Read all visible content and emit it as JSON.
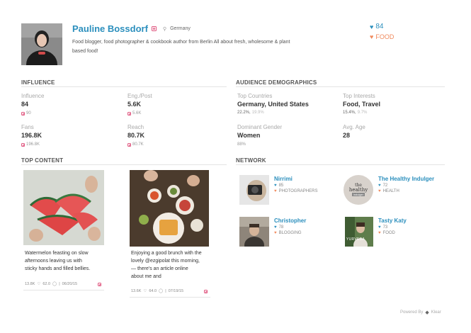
{
  "profile": {
    "name": "Pauline Bossdorf",
    "location": "Germany",
    "bio_line1": "Food blogger, food photographer & cookbook author from Berlin All about fresh, wholesome & plant",
    "bio_line2": "based food!",
    "score": "84",
    "category": "FOOD"
  },
  "influence": {
    "title": "INFLUENCE",
    "items": [
      {
        "label": "Influence",
        "value": "84",
        "sub": "90"
      },
      {
        "label": "Eng./Post",
        "value": "5.6K",
        "sub": "5.6K"
      },
      {
        "label": "Fans",
        "value": "196.8K",
        "sub": "196.8K"
      },
      {
        "label": "Reach",
        "value": "80.7K",
        "sub": "80.7K"
      }
    ]
  },
  "demographics": {
    "title": "AUDIENCE DEMOGRAPHICS",
    "top_countries_label": "Top Countries",
    "top_countries_value": "Germany, United States",
    "top_countries_sub_a": "22.2%,",
    "top_countries_sub_b": "19.9%",
    "top_interests_label": "Top Interests",
    "top_interests_value": "Food, Travel",
    "top_interests_sub_a": "15.4%,",
    "top_interests_sub_b": "9.7%",
    "gender_label": "Dominant Gender",
    "gender_value": "Women",
    "gender_sub": "88%",
    "age_label": "Avg. Age",
    "age_value": "28"
  },
  "top_content": {
    "title": "TOP CONTENT",
    "cards": [
      {
        "line1": "Watermelon feasting on slow",
        "line2": "afternoons leaving us with",
        "line3": "sticky hands and filled bellies.",
        "line4": "",
        "likes": "13.8K",
        "comments": "62.0",
        "date": "06/20/15"
      },
      {
        "line1": "Enjoying a good brunch with the",
        "line2": "lovely @ezgipolat this morning,",
        "line3": "— there's an article online",
        "line4": "about me and",
        "likes": "13.6K",
        "comments": "64.0",
        "date": "07/19/15"
      }
    ]
  },
  "network": {
    "title": "NETWORK",
    "items": [
      {
        "name": "Nirrimi",
        "score": "85",
        "topic": "PHOTOGRAPHERS"
      },
      {
        "name": "The Healthy Indulger",
        "score": "72",
        "topic": "HEALTH"
      },
      {
        "name": "Christopher",
        "score": "78",
        "topic": "BLOGGING"
      },
      {
        "name": "Tasty Katy",
        "score": "73",
        "topic": "FOOD"
      }
    ],
    "healthy_logo_line1": "the",
    "healthy_logo_line2": "healthy",
    "healthy_logo_line3": "indulger",
    "katy_logo_text": "YURVEDA"
  },
  "footer": {
    "powered_by": "Powered By",
    "brand": "Klear"
  },
  "colors": {
    "accent_blue": "#2b8fbd",
    "accent_orange": "#f08a5d",
    "instagram_pink": "#e0567f"
  }
}
